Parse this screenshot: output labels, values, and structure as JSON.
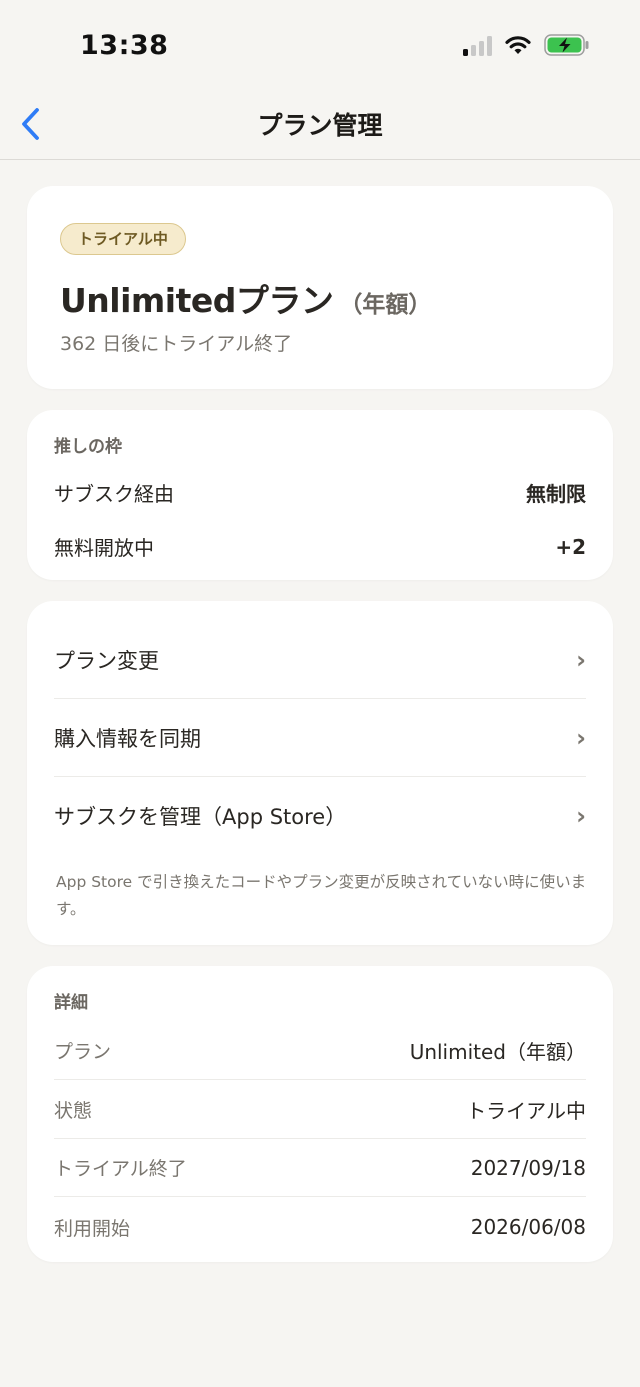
{
  "status_bar": {
    "time": "13:38",
    "signal_bars_on": 1,
    "signal_bars_total": 4,
    "battery_color": "#3cc24f",
    "battery_state": "charging"
  },
  "nav": {
    "back_icon": "chevron-left-icon",
    "title": "プラン管理",
    "accent_color": "#2f7cf6"
  },
  "plan": {
    "badge": "トライアル中",
    "name": "Unlimitedプラン",
    "period": "（年額）",
    "trial_remaining": "362 日後にトライアル終了"
  },
  "slots": {
    "label": "推しの枠",
    "rows": [
      {
        "label": "サブスク経由",
        "value": "無制限"
      },
      {
        "label": "無料開放中",
        "value": "+2"
      }
    ]
  },
  "actions": {
    "items": [
      {
        "label": "プラン変更",
        "icon": "chevron-right-icon"
      },
      {
        "label": "購入情報を同期",
        "icon": "chevron-right-icon"
      },
      {
        "label": "サブスクを管理（App Store）",
        "icon": "chevron-right-icon"
      }
    ],
    "chevron": "›",
    "note": "App Store で引き換えたコードやプラン変更が反映されていない時に使います。"
  },
  "details": {
    "label": "詳細",
    "rows": [
      {
        "key": "プラン",
        "value": "Unlimited（年額）"
      },
      {
        "key": "状態",
        "value": "トライアル中"
      },
      {
        "key": "トライアル終了",
        "value": "2027/09/18"
      },
      {
        "key": "利用開始",
        "value": "2026/06/08"
      }
    ]
  }
}
